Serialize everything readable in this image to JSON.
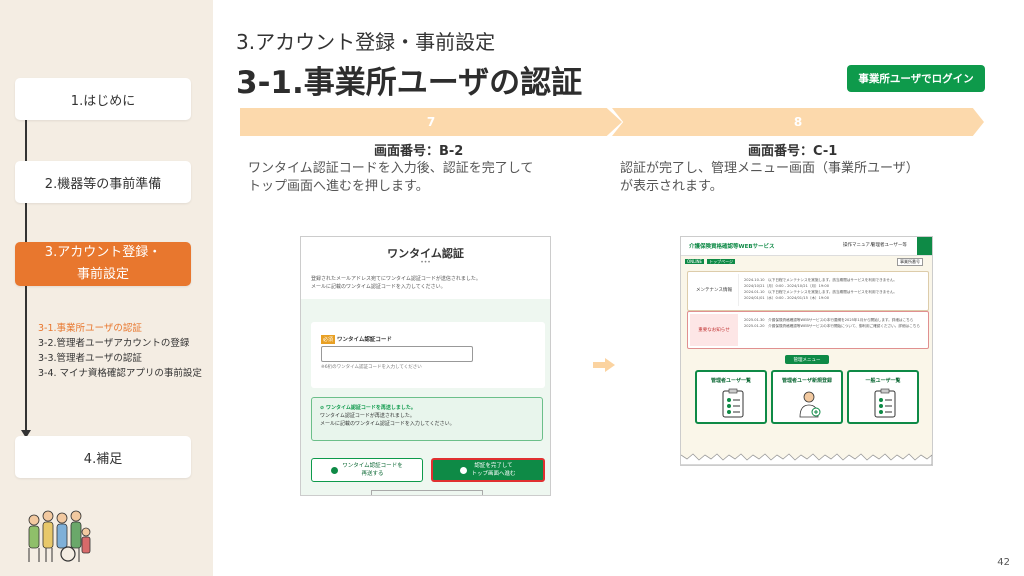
{
  "sidebar": {
    "items": [
      {
        "label": "1.はじめに"
      },
      {
        "label": "2.機器等の事前準備"
      },
      {
        "label_line1": "3.アカウント登録・",
        "label_line2": "事前設定"
      },
      {
        "label": "4.補足"
      }
    ],
    "subitems": [
      "3-1.事業所ユーザの認証",
      "3-2.管理者ユーザアカウントの登録",
      "3-3.管理者ユーザの認証",
      "3-4. マイナ資格確認アプリの事前設定"
    ],
    "illustration_icon": "people-group-icon"
  },
  "header": {
    "subtitle": "3.アカウント登録・事前設定",
    "title": "3-1.事業所ユーザの認証",
    "login_button": "事業所ユーザでログイン"
  },
  "steps": [
    {
      "number": "7",
      "screen_label": "画面番号：B-2",
      "description_line1": "ワンタイム認証コードを入力後、認証を完了して",
      "description_line2": "トップ画面へ進むを押します。"
    },
    {
      "number": "8",
      "screen_label": "画面番号：C-1",
      "description_line1": "認証が完了し、管理メニュー画面（事業所ユーザ）",
      "description_line2": "が表示されます。"
    }
  ],
  "screen1": {
    "title": "ワンタイム認証",
    "info_line1": "登録されたメールアドレス宛てにワンタイム認証コードが送信されました。",
    "info_line2": "メールに記載のワンタイム認証コードを入力してください。",
    "required": "必須",
    "field_label": "ワンタイム認証コード",
    "field_value": "",
    "hint": "※6桁のワンタイム認証コードを入力してください",
    "notice_title": "ワンタイム認証コードを再送しました。",
    "notice_line1": "ワンタイム認証コードが再送されました。",
    "notice_line2": "メールに記載のワンタイム認証コードを入力してください。",
    "resend_line1": "ワンタイム認証コードを",
    "resend_line2": "再送する",
    "complete_line1": "認証を完了して",
    "complete_line2": "トップ画面へ進む"
  },
  "screen2": {
    "logo": "介護保険資格確認等WEBサービス",
    "manual": "操作マニュアル",
    "user": "管理者ユーザー等",
    "crumb_tag": "ONLINE",
    "crumb_text": "トップページ",
    "no_button": "事業所番号",
    "maintenance_tag": "メンテナンス情報",
    "maintenance_lines": [
      "2024.10.10　以下日程でメンテナンスを実施します。該当期間はサービスを利用できません。",
      "2024/10/21（月）0:00 - 2024/10/21（月）19:00",
      "2024.01.10　以下日程でメンテナンスを実施します。該当期間はサービスを利用できません。",
      "2024/01/01（水）0:00 - 2024/01/15（木）19:00"
    ],
    "important_tag": "重要なお知らせ",
    "important_lines": [
      "2025.01.30　介護保険資格確認等WEBサービスの本行要綱を2025年1月から開始します。詳細はこちら",
      "2025.01.20　介護保険資格確認等WEBサービスの本行開始について、御利用ご確認ください。詳細はこちら"
    ],
    "menu_label": "管理メニュー",
    "cards": [
      "管理者ユーザ一覧",
      "管理者ユーザ新規登録",
      "一般ユーザ一覧"
    ]
  },
  "page_number": "42",
  "colors": {
    "accent": "#e8772e",
    "green": "#0e9a4b",
    "step": "#fcd9ac"
  }
}
